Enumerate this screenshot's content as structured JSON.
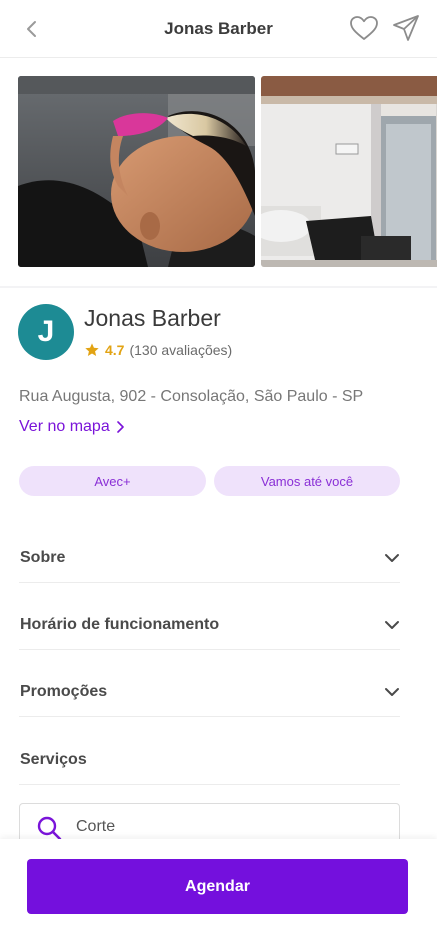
{
  "header": {
    "title": "Jonas Barber",
    "back_icon": "chevron-left-icon",
    "favorite_icon": "heart-icon",
    "share_icon": "send-icon"
  },
  "gallery": {
    "photos": [
      "barber-haircut-photo",
      "salon-interior-photo"
    ]
  },
  "business": {
    "avatar_letter": "J",
    "avatar_color": "#1d8b94",
    "name": "Jonas Barber",
    "rating": "4.7",
    "reviews": "(130 avaliações)",
    "address": "Rua Augusta, 902 - Consolação, São Paulo - SP",
    "map_link": "Ver no mapa"
  },
  "tags": [
    "Avec+",
    "Vamos até você"
  ],
  "sections": {
    "about": "Sobre",
    "hours": "Horário de funcionamento",
    "promotions": "Promoções",
    "services": "Serviços"
  },
  "search": {
    "value": "Corte"
  },
  "cta": {
    "label": "Agendar"
  },
  "colors": {
    "accent": "#7410dd",
    "star": "#e2a313",
    "chip_bg": "#efe2fb"
  }
}
